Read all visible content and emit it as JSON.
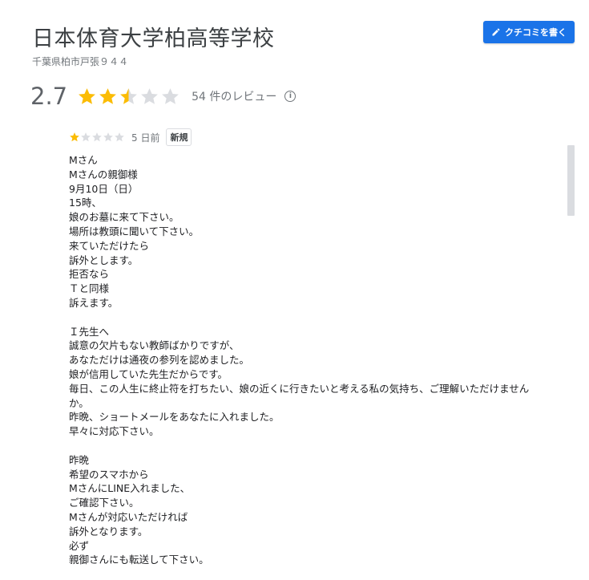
{
  "header": {
    "title": "日本体育大学柏高等学校",
    "address": "千葉県柏市戸張９４４",
    "write_review_label": "クチコミを書く",
    "write_review_icon": "pencil-icon"
  },
  "rating": {
    "value_text": "2.7",
    "value": 2.7,
    "max_stars": 5,
    "review_count_text": "54 件のレビュー",
    "info_icon": "info-icon",
    "star_color": "#fbbc04",
    "star_empty_color": "#dadce0"
  },
  "review": {
    "stars": 1,
    "date": "5 日前",
    "badge": "新規",
    "lines": [
      "Mさん",
      "Mさんの親御様",
      "9月10日（日）",
      "15時、",
      "娘のお墓に来て下さい。",
      "場所は教頭に聞いて下さい。",
      "来ていただけたら",
      "訴外とします。",
      "拒否なら",
      "Ｔと同様",
      "訴えます。",
      "",
      "Ｉ先生へ",
      "誠意の欠片もない教師ばかりですが、",
      "あなただけは通夜の参列を認めました。",
      "娘が信用していた先生だからです。",
      "毎日、この人生に終止符を打ちたい、娘の近くに行きたいと考える私の気持ち、ご理解いただけません",
      "か。",
      "昨晩、ショートメールをあなたに入れました。",
      "早々に対応下さい。",
      "",
      "昨晩",
      "希望のスマホから",
      "MさんにLINE入れました、",
      "ご確認下さい。",
      "Mさんが対応いただければ",
      "訴外となります。",
      "必ず",
      "親御さんにも転送して下さい。"
    ]
  },
  "colors": {
    "accent": "#1a73e8",
    "scrollbar": "#dadce0"
  }
}
